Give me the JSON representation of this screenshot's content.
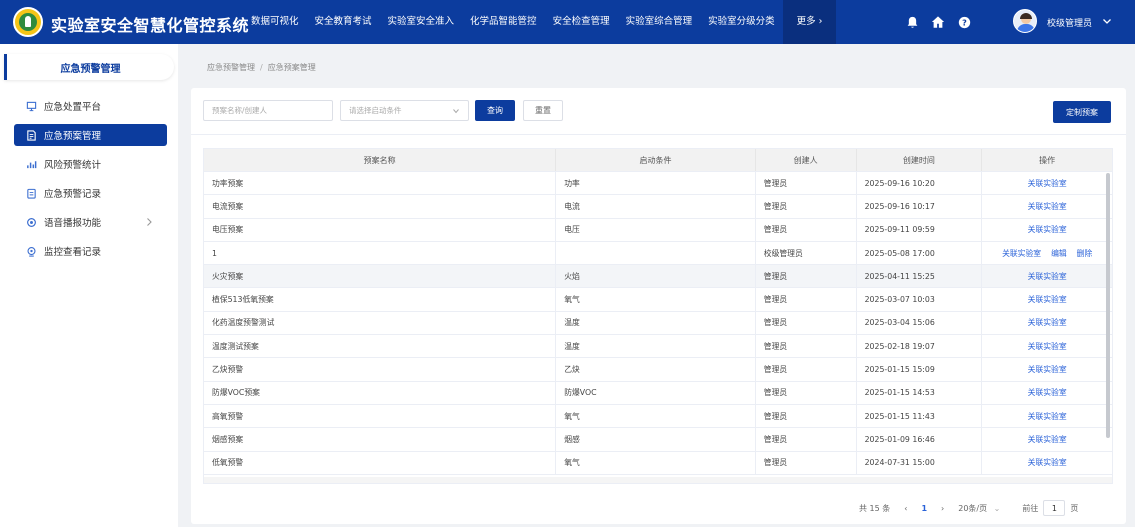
{
  "header": {
    "title": "实验室安全智慧化管控系统",
    "nav": [
      "数据可视化",
      "安全教育考试",
      "实验室安全准入",
      "化学品智能管控",
      "安全检查管理",
      "实验室综合管理",
      "实验室分级分类"
    ],
    "more": "更多 ›",
    "user": "校级管理员"
  },
  "sidebar": {
    "heading": "应急预警管理",
    "items": [
      {
        "label": "应急处置平台",
        "icon": "monitor-icon"
      },
      {
        "label": "应急预案管理",
        "icon": "document-icon"
      },
      {
        "label": "风险预警统计",
        "icon": "chart-icon"
      },
      {
        "label": "应急预警记录",
        "icon": "clipboard-icon"
      },
      {
        "label": "语音播报功能",
        "icon": "settings-icon"
      },
      {
        "label": "监控查看记录",
        "icon": "camera-icon"
      }
    ]
  },
  "breadcrumb": {
    "parent": "应急预警管理",
    "sep": "/",
    "current": "应急预案管理"
  },
  "filters": {
    "name_placeholder": "预案名称/创建人",
    "condition_placeholder": "请选择启动条件",
    "search": "查询",
    "reset": "重置",
    "create": "定制预案"
  },
  "table": {
    "columns": [
      "预案名称",
      "启动条件",
      "创建人",
      "创建时间",
      "操作"
    ],
    "rows": [
      {
        "name": "功率预案",
        "cond": "功率",
        "creator": "管理员",
        "time": "2025-09-16 10:20",
        "ops": [
          "关联实验室"
        ]
      },
      {
        "name": "电流预案",
        "cond": "电流",
        "creator": "管理员",
        "time": "2025-09-16 10:17",
        "ops": [
          "关联实验室"
        ]
      },
      {
        "name": "电压预案",
        "cond": "电压",
        "creator": "管理员",
        "time": "2025-09-11 09:59",
        "ops": [
          "关联实验室"
        ]
      },
      {
        "name": "1",
        "cond": "",
        "creator": "校级管理员",
        "time": "2025-05-08 17:00",
        "ops": [
          "关联实验室",
          "编辑",
          "删除"
        ]
      },
      {
        "name": "火灾预案",
        "cond": "火焰",
        "creator": "管理员",
        "time": "2025-04-11 15:25",
        "ops": [
          "关联实验室"
        ]
      },
      {
        "name": "植保513低氧预案",
        "cond": "氧气",
        "creator": "管理员",
        "time": "2025-03-07 10:03",
        "ops": [
          "关联实验室"
        ]
      },
      {
        "name": "化药温度预警测试",
        "cond": "温度",
        "creator": "管理员",
        "time": "2025-03-04 15:06",
        "ops": [
          "关联实验室"
        ]
      },
      {
        "name": "温度测试预案",
        "cond": "温度",
        "creator": "管理员",
        "time": "2025-02-18 19:07",
        "ops": [
          "关联实验室"
        ]
      },
      {
        "name": "乙炔预警",
        "cond": "乙炔",
        "creator": "管理员",
        "time": "2025-01-15 15:09",
        "ops": [
          "关联实验室"
        ]
      },
      {
        "name": "防爆VOC预案",
        "cond": "防爆VOC",
        "creator": "管理员",
        "time": "2025-01-15 14:53",
        "ops": [
          "关联实验室"
        ]
      },
      {
        "name": "高氧预警",
        "cond": "氧气",
        "creator": "管理员",
        "time": "2025-01-15 11:43",
        "ops": [
          "关联实验室"
        ]
      },
      {
        "name": "烟感预案",
        "cond": "烟感",
        "creator": "管理员",
        "time": "2025-01-09 16:46",
        "ops": [
          "关联实验室"
        ]
      },
      {
        "name": "低氧预警",
        "cond": "氧气",
        "creator": "管理员",
        "time": "2024-07-31 15:00",
        "ops": [
          "关联实验室"
        ]
      }
    ]
  },
  "pagination": {
    "total": "共 15 条",
    "prev": "‹",
    "page": "1",
    "next": "›",
    "size": "20条/页",
    "goto": "前往",
    "goto_value": "1",
    "unit": "页"
  },
  "colors": {
    "primary": "#0c3c9e",
    "link": "#2a62d8"
  }
}
